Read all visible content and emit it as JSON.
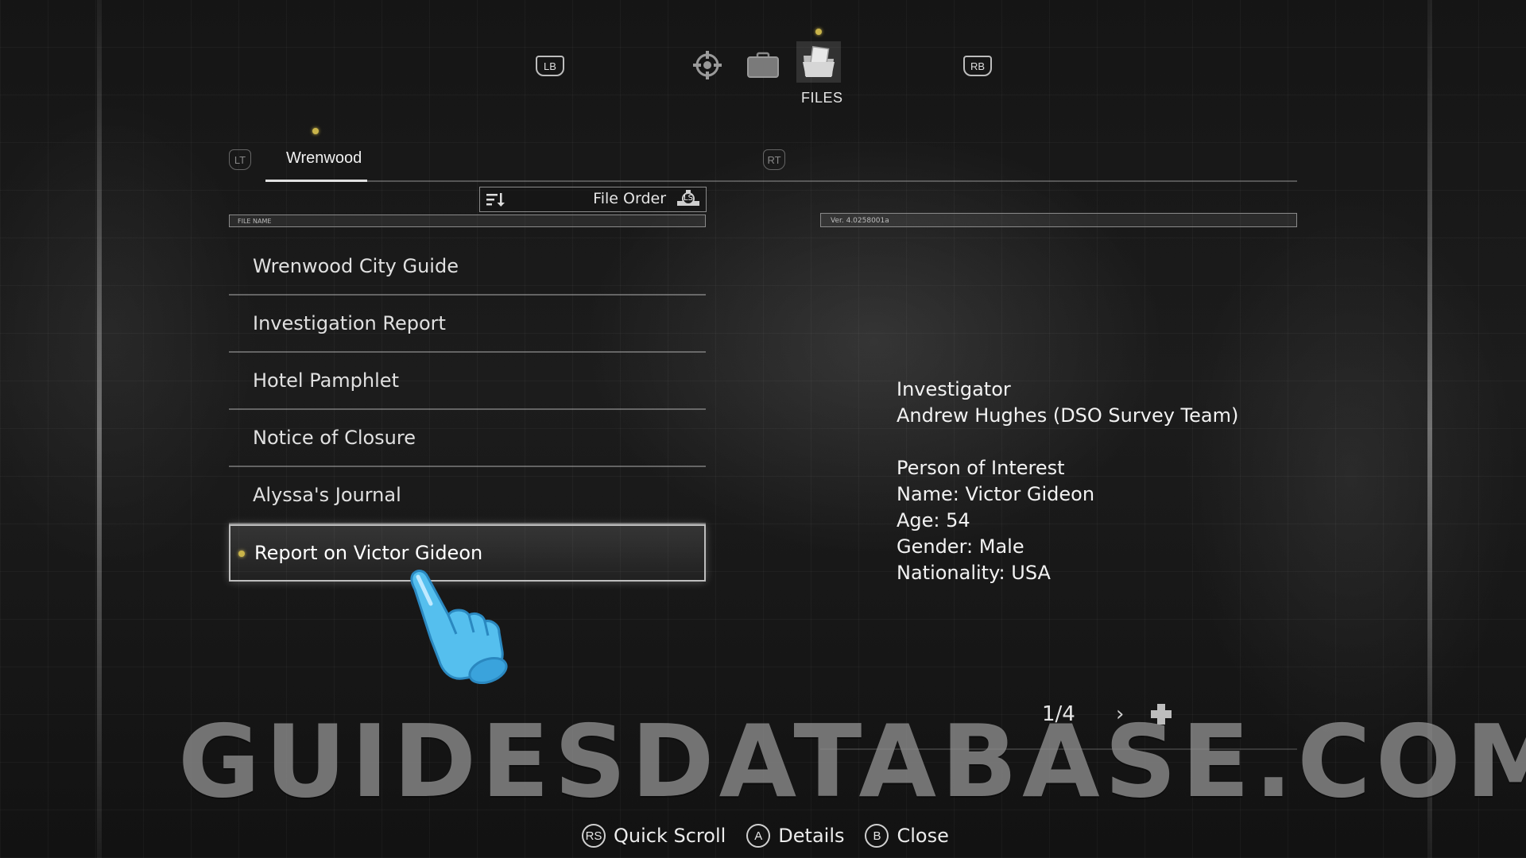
{
  "top_bar": {
    "left_bumper": "LB",
    "right_bumper": "RB",
    "categories": [
      {
        "icon": "compass-icon",
        "active": false
      },
      {
        "icon": "briefcase-icon",
        "active": false
      },
      {
        "icon": "files-icon",
        "active": true,
        "label": "FILES"
      }
    ]
  },
  "location_tabs": {
    "left_trigger": "LT",
    "right_trigger": "RT",
    "active": "Wrenwood"
  },
  "sort": {
    "label": "File Order",
    "stick": "LS"
  },
  "list_header": "FILE NAME",
  "files": [
    {
      "name": "Wrenwood City Guide",
      "selected": false
    },
    {
      "name": "Investigation Report",
      "selected": false
    },
    {
      "name": "Hotel Pamphlet",
      "selected": false
    },
    {
      "name": "Notice of Closure",
      "selected": false
    },
    {
      "name": "Alyssa's Journal",
      "selected": false
    },
    {
      "name": "Report on Victor Gideon",
      "selected": true
    }
  ],
  "details": {
    "version": "Ver. 4.0258001a",
    "investigator_heading": "Investigator",
    "investigator_name": "Andrew Hughes (DSO Survey Team)",
    "poi_heading": "Person of Interest",
    "name": "Name: Victor Gideon",
    "age": "Age: 54",
    "gender": "Gender: Male",
    "nationality": "Nationality: USA",
    "page": "1/4"
  },
  "footer": [
    {
      "glyph": "RS",
      "label": "Quick Scroll"
    },
    {
      "glyph": "A",
      "label": "Details"
    },
    {
      "glyph": "B",
      "label": "Close"
    }
  ],
  "watermark": "GUIDESDATABASE.COM",
  "colors": {
    "accent_dot": "#c9b44a",
    "text": "#e0e0e0",
    "cursor_hand": "#49b6e6"
  }
}
